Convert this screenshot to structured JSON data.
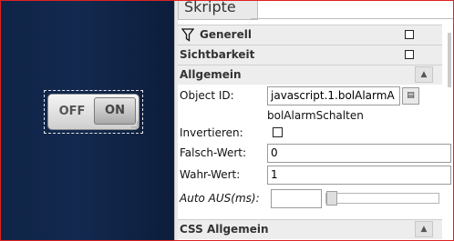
{
  "tab": {
    "label": "Skripte"
  },
  "sections": {
    "generell": {
      "label": "Generell"
    },
    "sichtbarkeit": {
      "label": "Sichtbarkeit"
    },
    "allgemein": {
      "label": "Allgemein"
    },
    "css_allgemein": {
      "label": "CSS Allgemein"
    }
  },
  "widget": {
    "off_label": "OFF",
    "on_label": "ON"
  },
  "fields": {
    "object_id": {
      "label": "Object ID:",
      "value": "javascript.1.bolAlarmA",
      "hint": "bolAlarmSchalten"
    },
    "invertieren": {
      "label": "Invertieren:"
    },
    "falsch_wert": {
      "label": "Falsch-Wert:",
      "value": "0"
    },
    "wahr_wert": {
      "label": "Wahr-Wert:",
      "value": "1"
    },
    "auto_aus": {
      "label": "Auto AUS(ms):",
      "value": ""
    }
  },
  "icons": {
    "filter": "filter-icon",
    "collapse": "chevron-up-icon",
    "picker": "list-picker-icon"
  },
  "colors": {
    "canvas_bg": "#13294f",
    "frame_border": "#dd2222",
    "header_bg": "#ededed"
  }
}
